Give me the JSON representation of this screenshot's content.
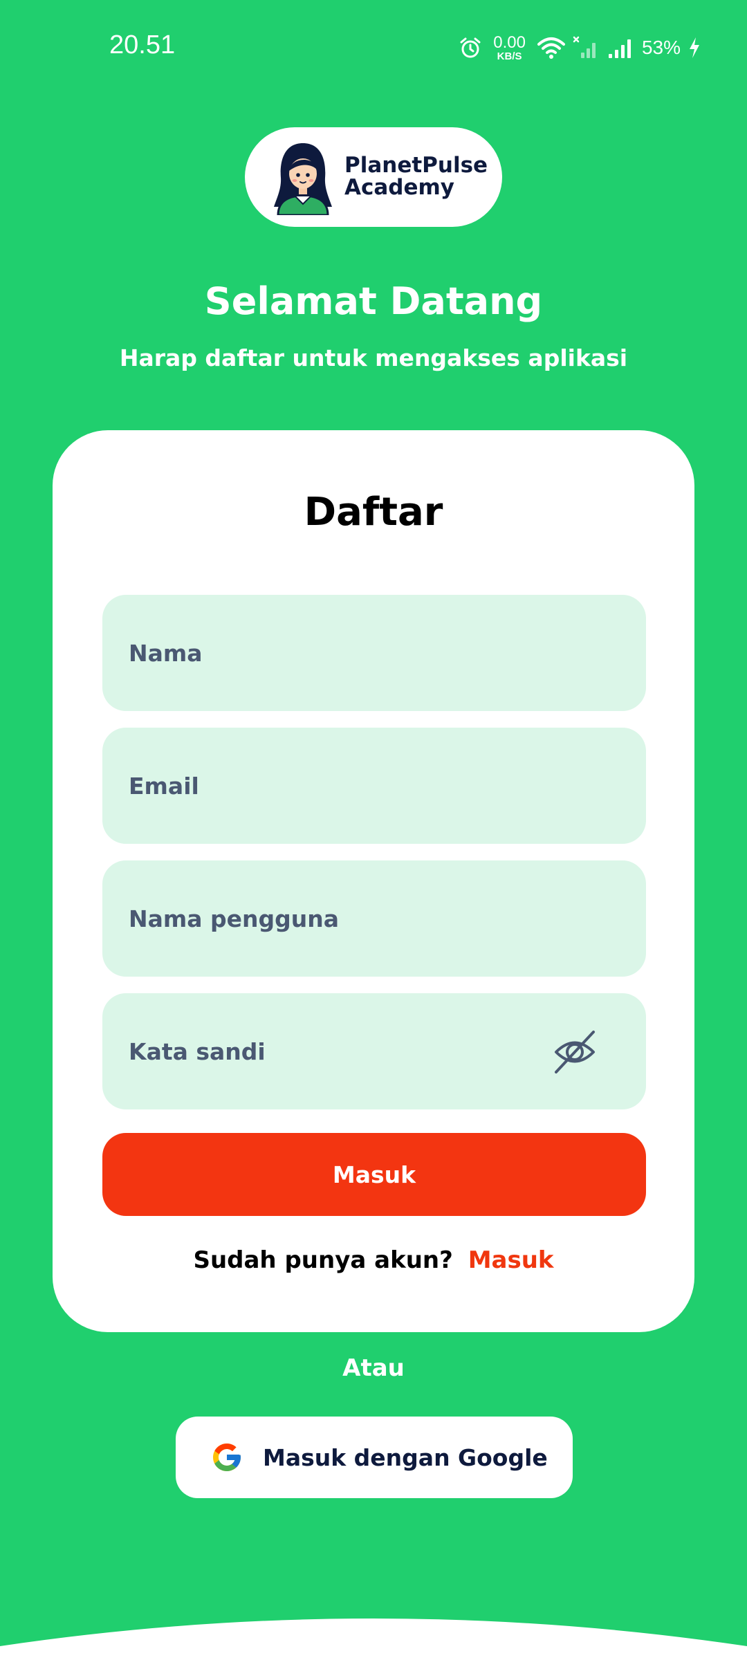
{
  "status_bar": {
    "time": "20.51",
    "net_speed_value": "0.00",
    "net_speed_unit": "KB/S",
    "battery": "53%",
    "icons": [
      "alarm-icon",
      "wifi-icon",
      "no-signal-icon",
      "signal-icon",
      "charging-icon"
    ]
  },
  "logo": {
    "line1": "PlanetPulse",
    "line2": "Academy"
  },
  "welcome": {
    "title": "Selamat Datang",
    "subtitle": "Harap daftar untuk mengakses aplikasi"
  },
  "form": {
    "title": "Daftar",
    "name_placeholder": "Nama",
    "email_placeholder": "Email",
    "username_placeholder": "Nama pengguna",
    "password_placeholder": "Kata sandi",
    "submit_label": "Masuk",
    "already_text": "Sudah punya akun?",
    "login_link": "Masuk"
  },
  "divider_text": "Atau",
  "google_button": {
    "label": "Masuk dengan Google"
  },
  "colors": {
    "background": "#20CF6E",
    "field_bg": "#DBF6E8",
    "accent": "#F33511",
    "text_dark": "#0E1A3D"
  }
}
